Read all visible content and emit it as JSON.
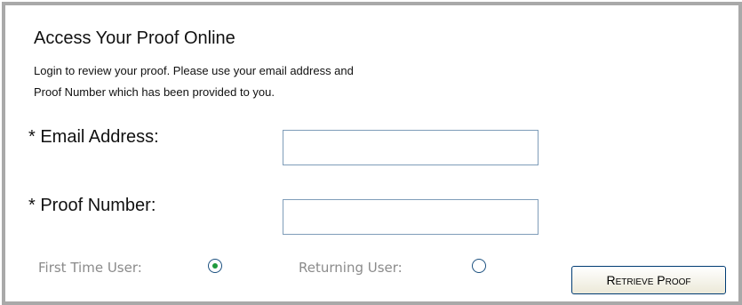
{
  "form": {
    "title": "Access Your Proof Online",
    "description_line1": "Login to review your proof. Please use your email address and",
    "description_line2": "Proof Number which has been provided to you.",
    "email_label": "* Email Address:",
    "email_value": "",
    "proof_label": "* Proof Number:",
    "proof_value": "",
    "first_time_label": "First Time User:",
    "first_time_selected": true,
    "returning_label": "Returning User:",
    "returning_selected": false,
    "retrieve_button_label": "Retrieve Proof"
  },
  "colors": {
    "border": "#a9a9a9",
    "input_border": "#7f9db9",
    "radio_label": "#8b8b8b",
    "radio_dot": "#1f9a3b"
  }
}
